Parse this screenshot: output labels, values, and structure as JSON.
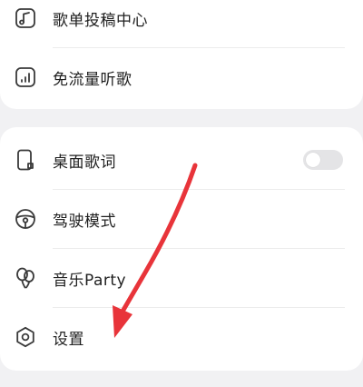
{
  "menu_top": {
    "items": [
      {
        "label": "歌单投稿中心",
        "icon": "music-note-square-icon"
      },
      {
        "label": "免流量听歌",
        "icon": "signal-bars-icon"
      }
    ]
  },
  "menu_bottom": {
    "items": [
      {
        "label": "桌面歌词",
        "icon": "phone-lyrics-icon",
        "toggle": false
      },
      {
        "label": "驾驶模式",
        "icon": "steering-wheel-icon"
      },
      {
        "label": "音乐Party",
        "icon": "balloons-icon"
      },
      {
        "label": "设置",
        "icon": "gear-icon"
      }
    ]
  },
  "colors": {
    "background": "#f1f1f3",
    "card": "#ffffff",
    "text": "#1f1f1f",
    "icon": "#3a3a3a",
    "toggle_off": "#e4e4e6",
    "annotation_arrow": "#e8343a"
  }
}
